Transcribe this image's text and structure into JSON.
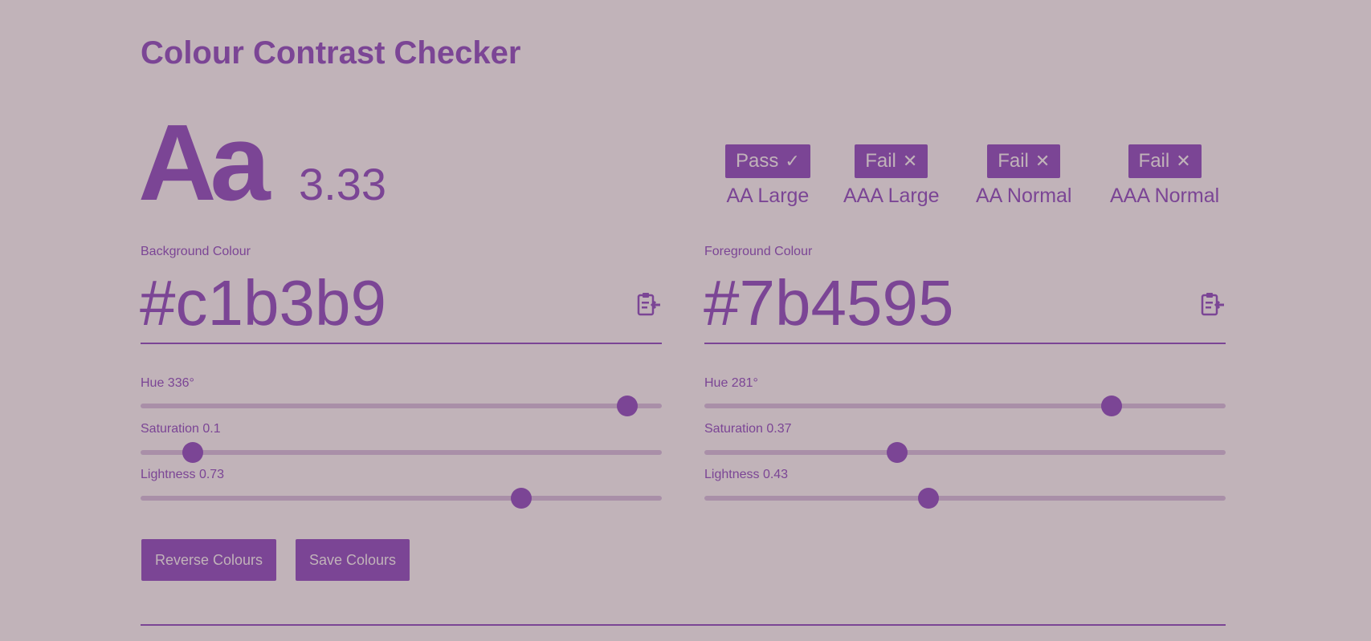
{
  "title": "Colour Contrast Checker",
  "preview": {
    "sample_text": "Aa",
    "contrast_ratio": "3.33"
  },
  "results": [
    {
      "status": "Pass",
      "icon": "✓",
      "icon_name": "checkmark-icon",
      "level": "AA Large"
    },
    {
      "status": "Fail",
      "icon": "✕",
      "icon_name": "cross-icon",
      "level": "AAA Large"
    },
    {
      "status": "Fail",
      "icon": "✕",
      "icon_name": "cross-icon",
      "level": "AA Normal"
    },
    {
      "status": "Fail",
      "icon": "✕",
      "icon_name": "cross-icon",
      "level": "AAA Normal"
    }
  ],
  "background": {
    "label": "Background Colour",
    "hex": "#c1b3b9",
    "paste_icon": "clipboard-paste-icon",
    "hue_label": "Hue 336°",
    "hue": 336,
    "saturation_label": "Saturation 0.1",
    "saturation": 0.1,
    "lightness_label": "Lightness 0.73",
    "lightness": 0.73
  },
  "foreground": {
    "label": "Foreground Colour",
    "hex": "#7b4595",
    "paste_icon": "clipboard-paste-icon",
    "hue_label": "Hue 281°",
    "hue": 281,
    "saturation_label": "Saturation 0.37",
    "saturation": 0.37,
    "lightness_label": "Lightness 0.43",
    "lightness": 0.43
  },
  "actions": {
    "reverse": "Reverse Colours",
    "save": "Save Colours"
  },
  "colors": {
    "background": "#c1b3b9",
    "foreground": "#7b4595",
    "track": "#a98fa8"
  }
}
